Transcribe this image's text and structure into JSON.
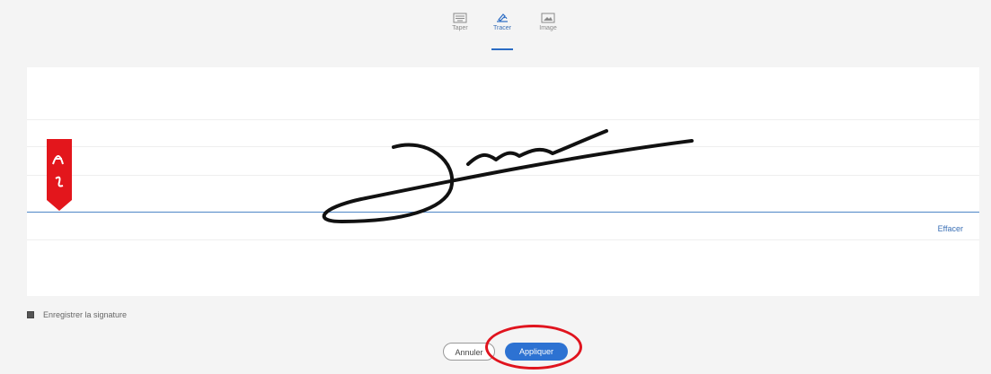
{
  "tabs": [
    {
      "label": "Taper",
      "icon": "keyboard-icon"
    },
    {
      "label": "Tracer",
      "icon": "draw-icon",
      "active": true
    },
    {
      "label": "Image",
      "icon": "image-icon"
    }
  ],
  "canvas": {
    "clear_label": "Effacer"
  },
  "save_signature_label": "Enregistrer la signature",
  "buttons": {
    "cancel_label": "Annuler",
    "apply_label": "Appliquer"
  },
  "colors": {
    "accent": "#2d72d2",
    "baseline": "#4d86c6",
    "marker": "#e3161c",
    "highlight_ring": "#e0141e"
  }
}
